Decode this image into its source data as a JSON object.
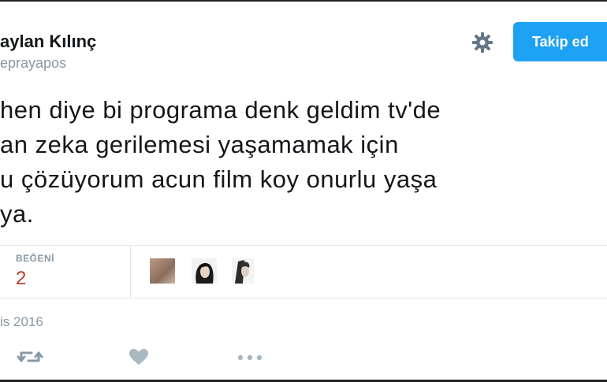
{
  "profile": {
    "display_name": "aylan Kılınç",
    "username": "eprayapos"
  },
  "follow_button": {
    "label": "Takip ed"
  },
  "tweet": {
    "lines": [
      "hen diye bi programa denk geldim tv'de",
      "an zeka gerilemesi yaşamamak için",
      "u çözüyorum acun film koy onurlu yaşa",
      "ya."
    ]
  },
  "stats": {
    "likes_label": "BEĞENİ",
    "likes_count": "2"
  },
  "date": "is 2016",
  "icons": {
    "settings": "gear-icon",
    "retweet": "retweet-icon",
    "like": "heart-icon",
    "more": "more-icon"
  },
  "colors": {
    "accent": "#1da1f2",
    "muted": "#8899a6",
    "likes": "#c0392b"
  }
}
